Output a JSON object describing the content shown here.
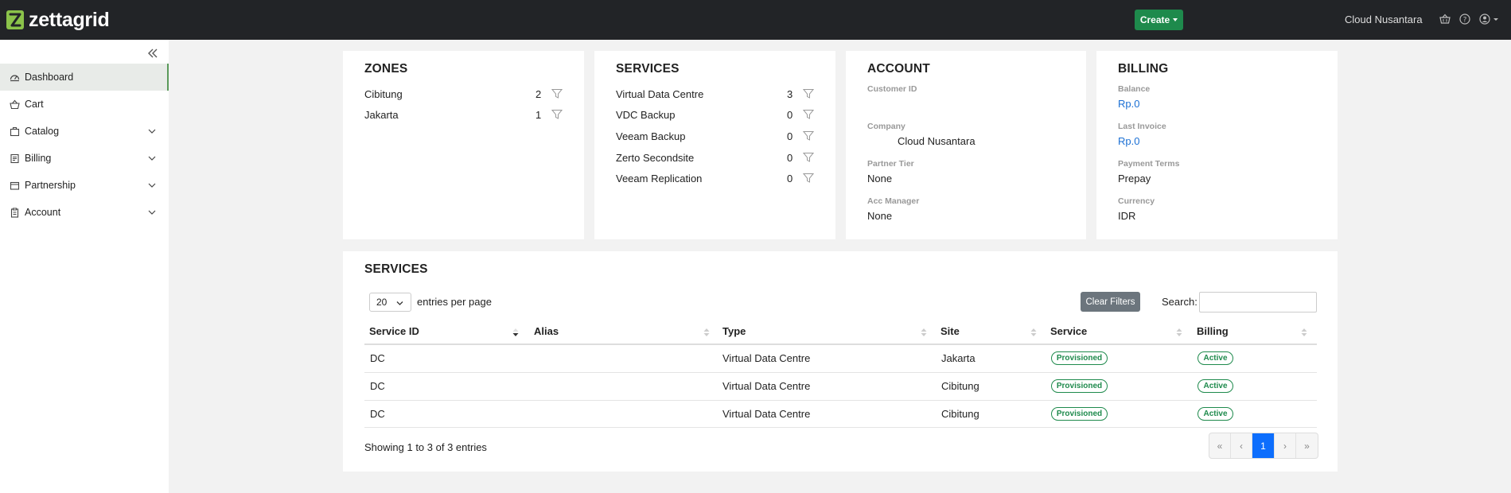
{
  "header": {
    "brand": "zettagrid",
    "create_label": "Create",
    "org_name": "Cloud Nusantara",
    "icons": [
      "basket-icon",
      "help-icon",
      "user-icon"
    ]
  },
  "sidebar": {
    "items": [
      {
        "label": "Dashboard",
        "icon": "dashboard-icon",
        "active": true,
        "expandable": false
      },
      {
        "label": "Cart",
        "icon": "cart-icon",
        "active": false,
        "expandable": false
      },
      {
        "label": "Catalog",
        "icon": "catalog-icon",
        "active": false,
        "expandable": true
      },
      {
        "label": "Billing",
        "icon": "billing-icon",
        "active": false,
        "expandable": true
      },
      {
        "label": "Partnership",
        "icon": "partnership-icon",
        "active": false,
        "expandable": true
      },
      {
        "label": "Account",
        "icon": "account-icon",
        "active": false,
        "expandable": true
      }
    ]
  },
  "zones": {
    "title": "ZONES",
    "items": [
      {
        "name": "Cibitung",
        "count": "2"
      },
      {
        "name": "Jakarta",
        "count": "1"
      }
    ]
  },
  "services_summary": {
    "title": "SERVICES",
    "items": [
      {
        "name": "Virtual Data Centre",
        "count": "3"
      },
      {
        "name": "VDC Backup",
        "count": "0"
      },
      {
        "name": "Veeam Backup",
        "count": "0"
      },
      {
        "name": "Zerto Secondsite",
        "count": "0"
      },
      {
        "name": "Veeam Replication",
        "count": "0"
      }
    ]
  },
  "account": {
    "title": "ACCOUNT",
    "customer_id_label": "Customer ID",
    "customer_id": "",
    "company_label": "Company",
    "company": "Cloud Nusantara",
    "partner_tier_label": "Partner Tier",
    "partner_tier": "None",
    "acc_manager_label": "Acc Manager",
    "acc_manager": "None"
  },
  "billing": {
    "title": "BILLING",
    "balance_label": "Balance",
    "balance": "Rp.0",
    "last_invoice_label": "Last Invoice",
    "last_invoice": "Rp.0",
    "payment_terms_label": "Payment Terms",
    "payment_terms": "Prepay",
    "currency_label": "Currency",
    "currency": "IDR"
  },
  "services_table": {
    "title": "SERVICES",
    "entries_value": "20",
    "entries_label": "entries per page",
    "clear_filters_label": "Clear Filters",
    "search_label": "Search:",
    "search_value": "",
    "columns": [
      "Service ID",
      "Alias",
      "Type",
      "Site",
      "Service",
      "Billing"
    ],
    "rows": [
      {
        "id": "DC",
        "alias": "",
        "type": "Virtual Data Centre",
        "site": "Jakarta",
        "service": "Provisioned",
        "billing": "Active"
      },
      {
        "id": "DC",
        "alias": "",
        "type": "Virtual Data Centre",
        "site": "Cibitung",
        "service": "Provisioned",
        "billing": "Active"
      },
      {
        "id": "DC",
        "alias": "",
        "type": "Virtual Data Centre",
        "site": "Cibitung",
        "service": "Provisioned",
        "billing": "Active"
      }
    ],
    "showing_text": "Showing 1 to 3 of 3 entries",
    "pagination": {
      "first": "«",
      "prev": "‹",
      "current": "1",
      "next": "›",
      "last": "»"
    }
  },
  "colors": {
    "topbar": "#222427",
    "brand_green": "#8bc34a",
    "create_button": "#1e8a4c",
    "link": "#1a6fd4",
    "badge_green": "#1e8a4c",
    "pager_active": "#0d6efd"
  }
}
